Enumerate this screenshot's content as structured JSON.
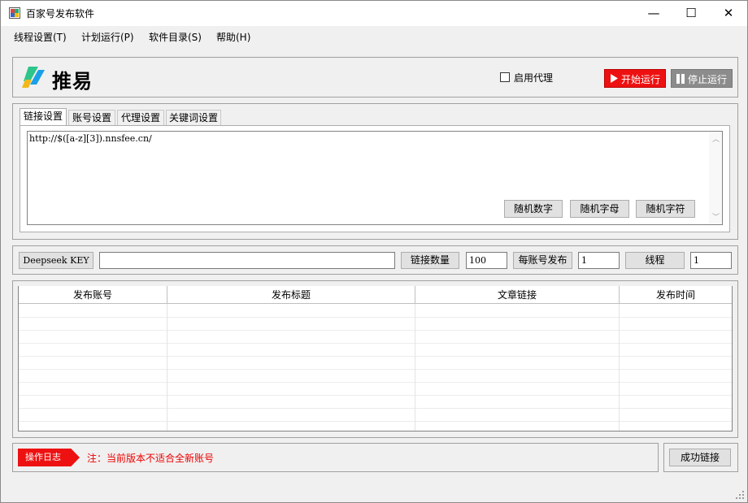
{
  "window": {
    "title": "百家号发布软件",
    "minimize_glyph": "—",
    "maximize_glyph": "☐",
    "close_glyph": "✕"
  },
  "menu": [
    "线程设置(T)",
    "计划运行(P)",
    "软件目录(S)",
    "帮助(H)"
  ],
  "header": {
    "logo_text": "推易",
    "proxy_label": "启用代理",
    "proxy_checked": false,
    "start_label": "开始运行",
    "stop_label": "停止运行",
    "start_color": "#ee1111",
    "stop_color": "#8c8c8c"
  },
  "tabs": [
    "链接设置",
    "账号设置",
    "代理设置",
    "关键词设置"
  ],
  "link_settings": {
    "url_text": "http://$([a-z][3]).nnsfee.cn/",
    "random_number_label": "随机数字",
    "random_letter_label": "随机字母",
    "random_symbol_label": "随机字符"
  },
  "config": {
    "deepseek_label": "Deepseek KEY",
    "deepseek_value": "",
    "link_count_label": "链接数量",
    "link_count_value": "100",
    "per_account_label": "每账号发布",
    "per_account_value": "1",
    "thread_label": "线程",
    "thread_value": "1"
  },
  "table": {
    "columns": [
      "发布账号",
      "发布标题",
      "文章链接",
      "发布时间"
    ],
    "rows": []
  },
  "log": {
    "tag_label": "操作日志",
    "notice": "注：当前版本不适合全新账号",
    "notice_color": "#ee0000",
    "success_link_label": "成功链接"
  }
}
